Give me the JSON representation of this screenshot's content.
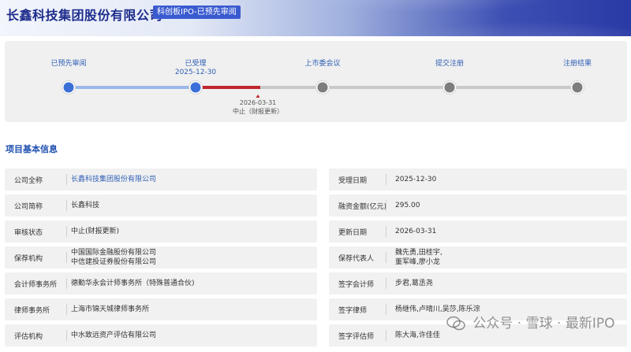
{
  "header": {
    "company_name": "长鑫科技集团股份有限公司",
    "status_tag": "科创板IPO-已预先审阅"
  },
  "progress": {
    "steps": [
      {
        "label": "已预先审阅",
        "date": "",
        "state": "done"
      },
      {
        "label": "已受理",
        "date": "2025-12-30",
        "state": "done"
      },
      {
        "label": "上市委会议",
        "date": "",
        "state": "pending"
      },
      {
        "label": "提交注册",
        "date": "",
        "state": "pending"
      },
      {
        "label": "注册结果",
        "date": "",
        "state": "pending"
      }
    ],
    "pause": {
      "date": "2026-03-31",
      "note": "中止（财报更新）"
    },
    "colors": {
      "done": "#3a6fd8",
      "pending": "#8a8a8a",
      "paused": "#c0262c",
      "track": "#cfcfcf"
    }
  },
  "section": {
    "title": "项目基本信息"
  },
  "info": {
    "left": [
      {
        "label": "公司全称",
        "value": [
          "长鑫科技集团股份有限公司"
        ],
        "link": true
      },
      {
        "label": "公司简称",
        "value": [
          "长鑫科技"
        ]
      },
      {
        "label": "审核状态",
        "value": [
          "中止(财报更新)"
        ]
      },
      {
        "label": "保荐机构",
        "value": [
          "中国国际金融股份有限公司",
          "中信建投证券股份有限公司"
        ]
      },
      {
        "label": "会计师事务所",
        "value": [
          "德勤华永会计师事务所（特殊普通合伙)"
        ]
      },
      {
        "label": "律师事务所",
        "value": [
          "上海市锦天城律师事务所"
        ]
      },
      {
        "label": "评估机构",
        "value": [
          "中水致远资产评估有限公司"
        ]
      }
    ],
    "right": [
      {
        "label": "受理日期",
        "value": [
          "2025-12-30"
        ]
      },
      {
        "label": "融资金额(亿元)",
        "value": [
          "295.00"
        ]
      },
      {
        "label": "更新日期",
        "value": [
          "2026-03-31"
        ]
      },
      {
        "label": "保荐代表人",
        "value": [
          "魏先勇,田桂宇,",
          "董军峰,廖小龙"
        ]
      },
      {
        "label": "签字会计师",
        "value": [
          "步君,葛丞尧"
        ]
      },
      {
        "label": "签字律师",
        "value": [
          "杨继伟,卢晴川,吴莎,陈乐淙"
        ]
      },
      {
        "label": "签字评估师",
        "value": [
          "陈大海,许佳佳"
        ]
      }
    ]
  },
  "watermark": {
    "text": "公众号 · 雪球 · 最新IPO"
  }
}
